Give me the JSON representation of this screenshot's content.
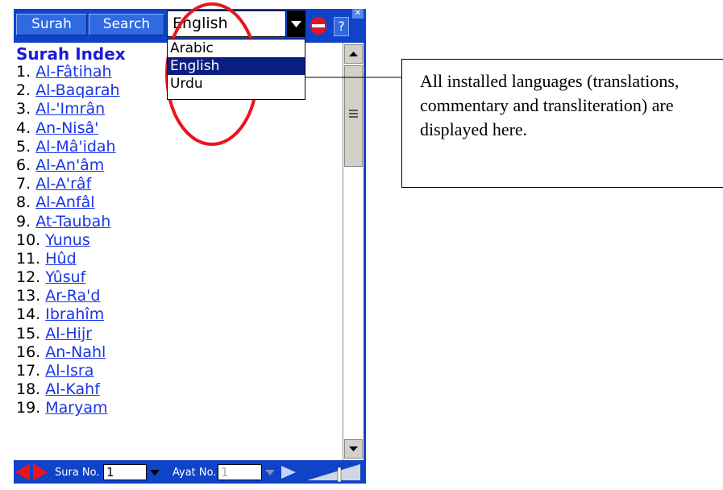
{
  "toolbar": {
    "surah_label": "Surah",
    "search_label": "Search",
    "language_value": "English",
    "help_label": "?",
    "close_label": "✕"
  },
  "language_dropdown": {
    "options": [
      "Arabic",
      "English",
      "Urdu"
    ],
    "selected": "English"
  },
  "content": {
    "title": "Surah Index",
    "surahs": [
      {
        "num": "1.",
        "name": "Al-Fâtihah"
      },
      {
        "num": "2.",
        "name": "Al-Baqarah"
      },
      {
        "num": "3.",
        "name": "Al-'Imrân"
      },
      {
        "num": "4.",
        "name": "An-Nisâ'"
      },
      {
        "num": "5.",
        "name": "Al-Mâ'idah"
      },
      {
        "num": "6.",
        "name": "Al-An'âm"
      },
      {
        "num": "7.",
        "name": "Al-A'râf"
      },
      {
        "num": "8.",
        "name": "Al-Anfâl"
      },
      {
        "num": "9.",
        "name": "At-Taubah"
      },
      {
        "num": "10.",
        "name": "Yunus"
      },
      {
        "num": "11.",
        "name": "Hûd"
      },
      {
        "num": "12.",
        "name": "Yûsuf"
      },
      {
        "num": "13.",
        "name": "Ar-Ra'd"
      },
      {
        "num": "14.",
        "name": "Ibrahîm"
      },
      {
        "num": "15.",
        "name": "Al-Hijr"
      },
      {
        "num": "16.",
        "name": "An-Nahl"
      },
      {
        "num": "17.",
        "name": "Al-Isra"
      },
      {
        "num": "18.",
        "name": "Al-Kahf"
      },
      {
        "num": "19.",
        "name": "Maryam"
      }
    ]
  },
  "bottom_bar": {
    "sura_label": "Sura No.",
    "sura_value": "1",
    "ayat_label": "Ayat No.",
    "ayat_value": "1"
  },
  "annotation": {
    "callout_text": "All installed languages (translations, commentary and transliteration) are displayed here."
  },
  "colors": {
    "frame_blue": "#0f43c8",
    "link_blue": "#1a35e6",
    "title_blue": "#1b1bd8",
    "highlight_red": "#e8141e",
    "selected_bg": "#0a1e80"
  },
  "icons": [
    "chevron-down-icon",
    "stop-icon",
    "help-icon",
    "close-icon",
    "scroll-up-icon",
    "scroll-down-icon",
    "prev-next-icon",
    "play-icon",
    "volume-icon"
  ]
}
